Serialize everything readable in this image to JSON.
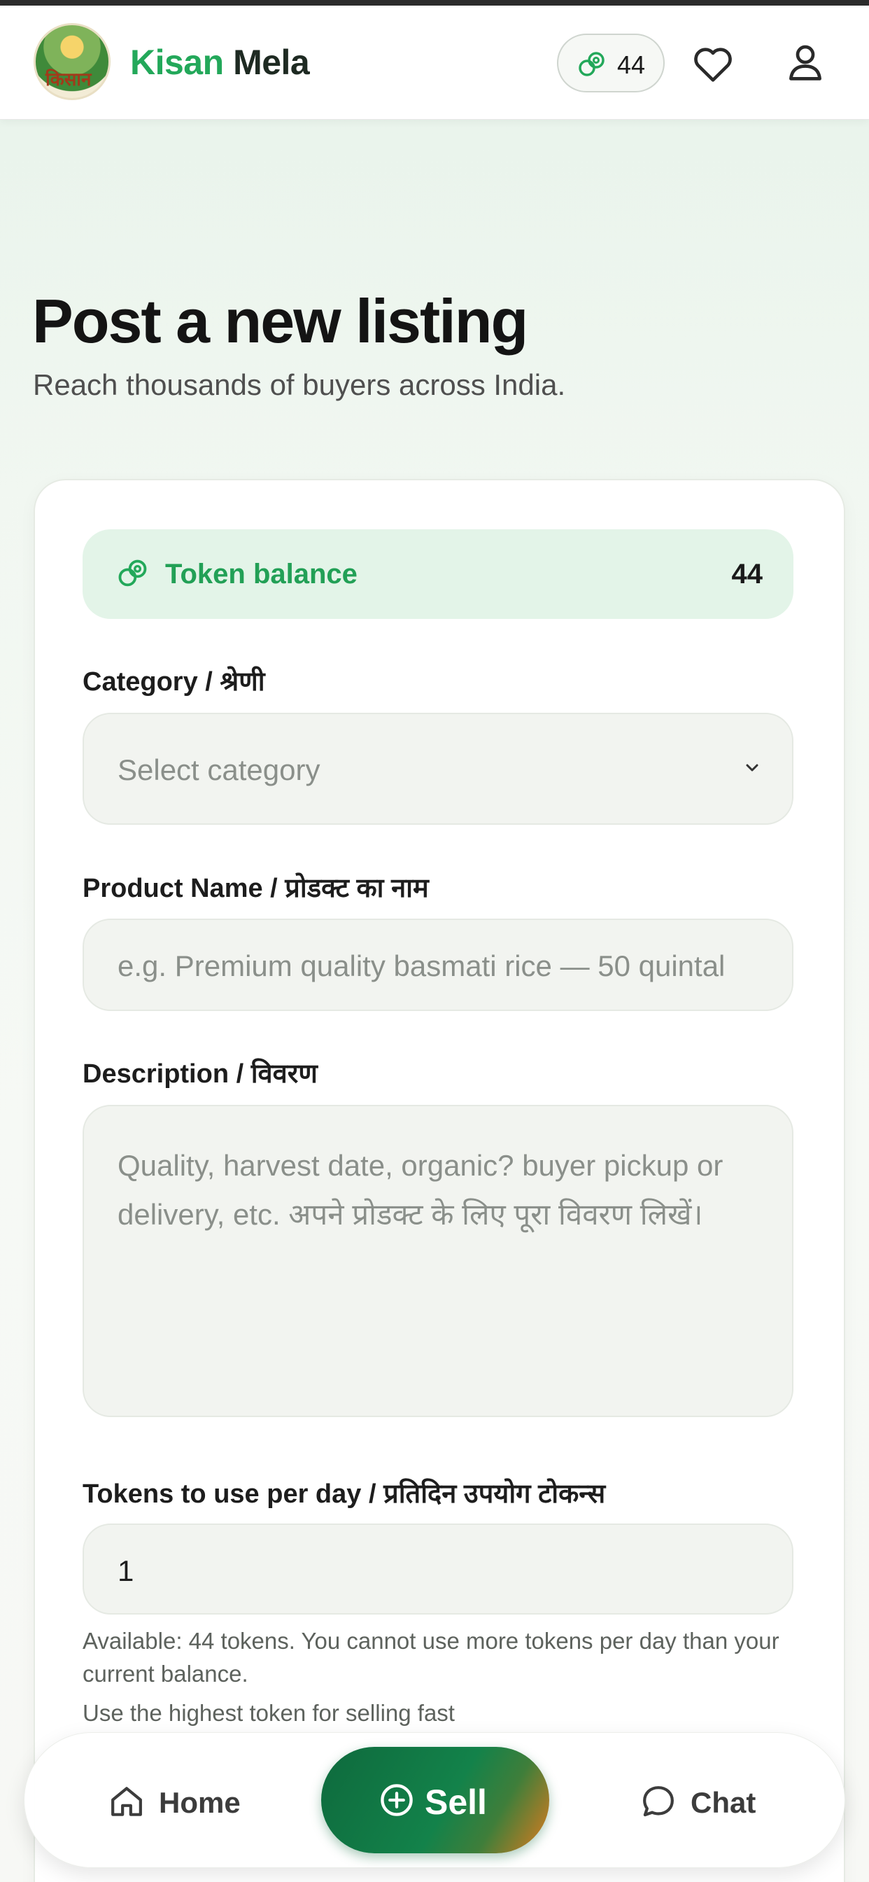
{
  "header": {
    "brand_part1": "Kisan",
    "brand_part2": "Mela",
    "logo_text": "किसान",
    "token_count": "44",
    "accent_color": "#23a85a"
  },
  "page": {
    "title": "Post a new listing",
    "subtitle": "Reach thousands of buyers across India."
  },
  "form": {
    "balance_label": "Token balance",
    "balance_value": "44",
    "category_label": "Category / श्रेणी",
    "category_placeholder": "Select category",
    "product_label": "Product Name / प्रोडक्ट का नाम",
    "product_placeholder": "e.g. Premium quality basmati rice — 50 quintal",
    "description_label": "Description / विवरण",
    "description_placeholder": "Quality, harvest date, organic? buyer pickup or delivery, etc. अपने प्रोडक्ट के लिए पूरा विवरण लिखें।",
    "tokens_label": "Tokens to use per day / प्रतिदिन उपयोग टोकन्स",
    "tokens_value": "1",
    "help_available": "Available: 44 tokens. You cannot use more tokens per day than your current balance.",
    "help_tip": "Use the highest token for selling fast"
  },
  "bottom_nav": {
    "home": "Home",
    "sell": "Sell",
    "chat": "Chat"
  }
}
